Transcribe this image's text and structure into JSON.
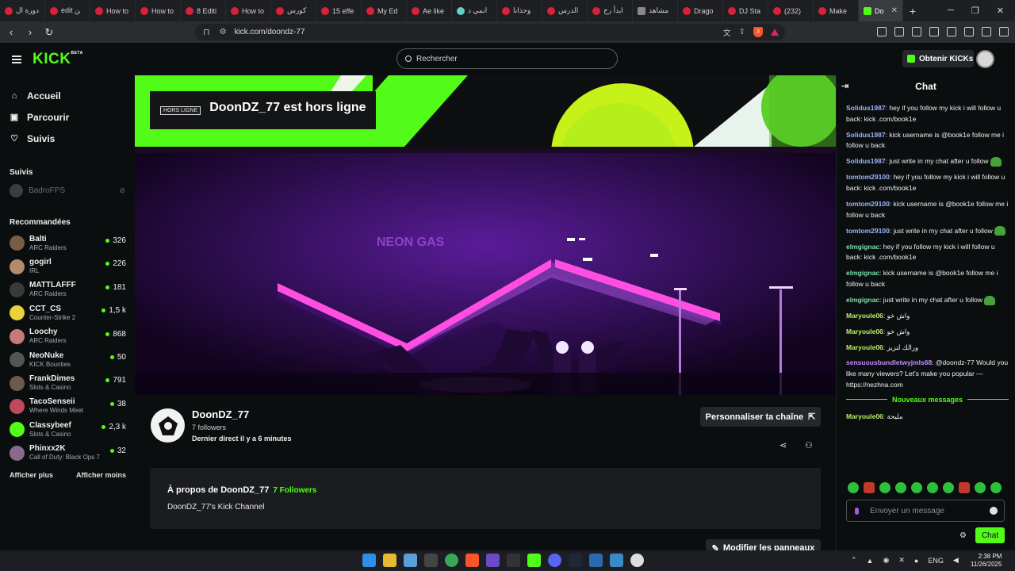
{
  "browser": {
    "tabs": [
      {
        "label": "دورة ال",
        "icon": "youtube"
      },
      {
        "label": "edit ﻦ",
        "icon": "youtube"
      },
      {
        "label": "How to",
        "icon": "youtube"
      },
      {
        "label": "How to",
        "icon": "youtube"
      },
      {
        "label": "8 Editi",
        "icon": "youtube"
      },
      {
        "label": "How to",
        "icon": "youtube"
      },
      {
        "label": "كورس",
        "icon": "youtube"
      },
      {
        "label": "15 effe",
        "icon": "youtube"
      },
      {
        "label": "My Ed",
        "icon": "youtube"
      },
      {
        "label": "Ae like",
        "icon": "youtube"
      },
      {
        "label": "انمي د",
        "icon": "globe"
      },
      {
        "label": "وحذانا",
        "icon": "youtube"
      },
      {
        "label": "الدرس",
        "icon": "youtube"
      },
      {
        "label": "ابدأ رح",
        "icon": "youtube"
      },
      {
        "label": "مشاهد",
        "icon": "page"
      },
      {
        "label": "Drago",
        "icon": "youtube"
      },
      {
        "label": "DJ Sta",
        "icon": "youtube"
      },
      {
        "label": "(232)",
        "icon": "youtube"
      },
      {
        "label": "Make",
        "icon": "youtube"
      }
    ],
    "active_tab": {
      "label": "Do",
      "close": "✕"
    },
    "new_tab": "+",
    "url": "kick.com/doondz-77"
  },
  "header": {
    "logo": "KICK",
    "logo_badge": "BETA",
    "search_placeholder": "Rechercher",
    "get_kicks": "Obtenir KICKs"
  },
  "sidebar": {
    "nav": [
      {
        "label": "Accueil",
        "icon": "home-icon",
        "glyph": "⌂"
      },
      {
        "label": "Parcourir",
        "icon": "browse-icon",
        "glyph": "▣"
      },
      {
        "label": "Suivis",
        "icon": "heart-icon",
        "glyph": "♡"
      }
    ],
    "followed_title": "Suivis",
    "followed": [
      {
        "name": "BadroFPS"
      }
    ],
    "recommended_title": "Recommandées",
    "recommended": [
      {
        "name": "Balti",
        "category": "ARC Raiders",
        "viewers": "326",
        "color": "#7a5c44"
      },
      {
        "name": "gogirl",
        "category": "IRL",
        "viewers": "226",
        "color": "#b28a6c"
      },
      {
        "name": "MATTLAFFF",
        "category": "ARC Raiders",
        "viewers": "181",
        "color": "#3a3a3a"
      },
      {
        "name": "CCT_CS",
        "category": "Counter-Strike 2",
        "viewers": "1,5 k",
        "color": "#e8d23a"
      },
      {
        "name": "Loochy",
        "category": "ARC Raiders",
        "viewers": "868",
        "color": "#c87a7a"
      },
      {
        "name": "NeoNuke",
        "category": "KICK Bounties",
        "viewers": "50",
        "color": "#555555"
      },
      {
        "name": "FrankDimes",
        "category": "Slots & Casino",
        "viewers": "791",
        "color": "#6e5a4a"
      },
      {
        "name": "TacoSenseii",
        "category": "Where Winds Meet",
        "viewers": "38",
        "color": "#c04a5a"
      },
      {
        "name": "Classybeef",
        "category": "Slots & Casino",
        "viewers": "2,3 k",
        "color": "#53fc18"
      },
      {
        "name": "Phinxx2K",
        "category": "Call of Duty: Black Ops 7",
        "viewers": "32",
        "color": "#8a6a8a"
      }
    ],
    "show_more": "Afficher plus",
    "show_less": "Afficher moins"
  },
  "channel": {
    "offline_tag": "HORS LIGNE",
    "offline_message": "DoonDZ_77 est hors ligne",
    "name": "DoonDZ_77",
    "followers": "7 followers",
    "last_live": "Dernier direct il y a 6 minutes",
    "customize_button": "Personnaliser ta chaîne",
    "about_title": "À propos de DoonDZ_77",
    "about_followers": "7 Followers",
    "about_description": "DoonDZ_77's Kick Channel",
    "edit_panels_button": "Modifier les panneaux",
    "video_sign": "NEON GAS"
  },
  "chat": {
    "title": "Chat",
    "messages": [
      {
        "user": "Solidus1987",
        "color": "#9fb3ff",
        "text": "hey if you follow my kick i will follow u back: kick .com/book1e"
      },
      {
        "user": "Solidus1987",
        "color": "#9fb3ff",
        "text": "kick username is @book1e follow me i follow u back"
      },
      {
        "user": "Solidus1987",
        "color": "#9fb3ff",
        "text": "just write in my chat after u follow",
        "emote": true
      },
      {
        "user": "tomtom29100",
        "color": "#9fb3ff",
        "text": "hey if you follow my kick i will follow u back: kick .com/book1e"
      },
      {
        "user": "tomtom29100",
        "color": "#9fb3ff",
        "text": "kick username is @book1e follow me i follow u back"
      },
      {
        "user": "tomtom29100",
        "color": "#9fb3ff",
        "text": "just write in my chat after u follow",
        "emote": true
      },
      {
        "user": "elmgignac",
        "color": "#7ee0b0",
        "text": "hey if you follow my kick i will follow u back: kick .com/book1e"
      },
      {
        "user": "elmgignac",
        "color": "#7ee0b0",
        "text": "kick username is @book1e follow me i follow u back"
      },
      {
        "user": "elmgignac",
        "color": "#7ee0b0",
        "text": "just write in my chat after u follow",
        "emote": true
      },
      {
        "user": "Maryoule06",
        "color": "#b5f06a",
        "text": "واش خو"
      },
      {
        "user": "Maryoule06",
        "color": "#b5f06a",
        "text": "واش خو"
      },
      {
        "user": "Maryoule06",
        "color": "#b5f06a",
        "text": "ورالك لتزيز"
      },
      {
        "user": "sensuousbundletwyjmls68",
        "color": "#c38cff",
        "text": "@doondz-77 Would you like many viewers? Let's make you popular — https://nezhna.com"
      }
    ],
    "new_messages_label": "Nouveaux messages",
    "after_new": [
      {
        "user": "Maryoule06",
        "color": "#b5f06a",
        "text": "مليحة"
      }
    ],
    "input_placeholder": "Envoyer un message",
    "send_button": "Chat"
  },
  "taskbar": {
    "language": "ENG",
    "time": "2:38 PM",
    "date": "11/26/2025"
  },
  "colors": {
    "brand": "#53fc18",
    "background": "#0b0e0f"
  }
}
